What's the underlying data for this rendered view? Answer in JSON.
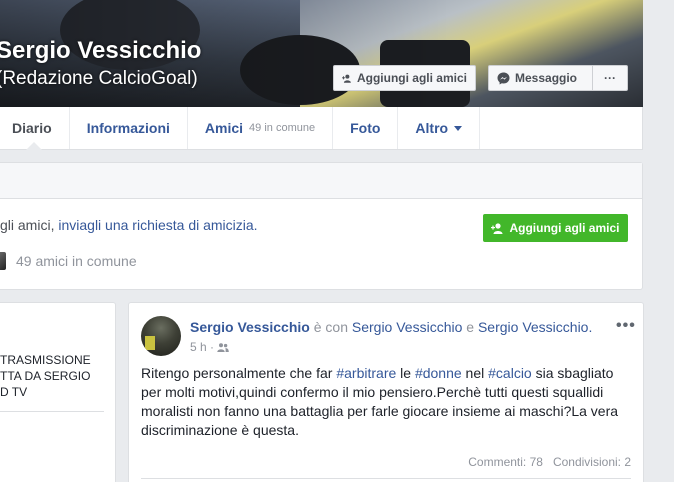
{
  "profile": {
    "name": "Sergio Vessicchio",
    "subtitle": "(Redazione CalcioGoal)"
  },
  "cover_buttons": {
    "add_friend": "Aggiungi agli amici",
    "message": "Messaggio",
    "more": "···"
  },
  "tabs": [
    {
      "label": "Diario"
    },
    {
      "label": "Informazioni"
    },
    {
      "label": "Amici",
      "count": "49 in comune"
    },
    {
      "label": "Foto"
    },
    {
      "label": "Altro"
    }
  ],
  "friend_request": {
    "text_prefix": "gli amici, ",
    "link": "inviagli una richiesta di amicizia.",
    "mutual": "49 amici in comune",
    "button": "Aggiungi agli amici"
  },
  "left_card": {
    "lines": [
      "TRASMISSIONE",
      "TTA DA SERGIO",
      "D TV"
    ]
  },
  "post": {
    "author": "Sergio Vessicchio",
    "with_text": " è con ",
    "tagged1": "Sergio Vessicchio",
    "and_text": " e ",
    "tagged2": "Sergio Vessicchio.",
    "time": "5 h",
    "dot": " · ",
    "options": "•••",
    "body": {
      "t1": "Ritengo personalmente che far ",
      "h1": "#arbitrare",
      "t2": " le ",
      "h2": "#donne",
      "t3": " nel ",
      "h3": "#calcio",
      "t4": " sia sbagliato per molti motivi,quindi confermo il mio pensiero.Perchè tutti questi squallidi moralisti non fanno una battaglia per farle giocare insieme ai maschi?La vera discriminazione è questa."
    },
    "comments": "Commenti: 78",
    "shares": "Condivisioni: 2"
  },
  "colors": {
    "link": "#365899",
    "green_button": "#42b72a",
    "background": "#e9ebee"
  }
}
